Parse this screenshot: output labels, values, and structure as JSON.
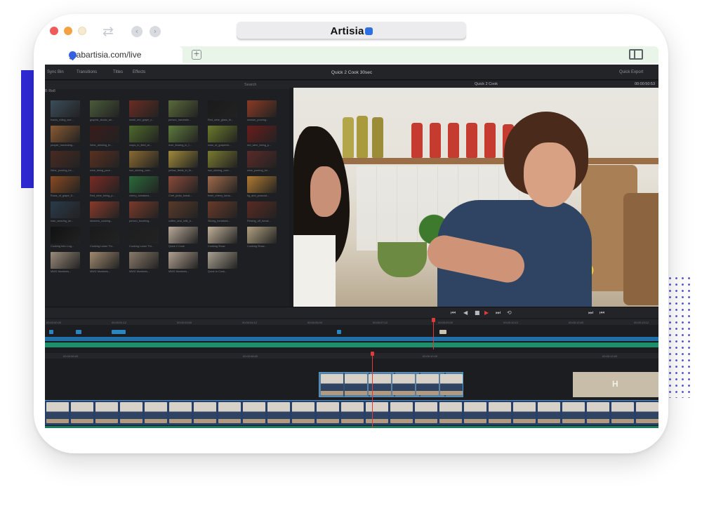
{
  "browser": {
    "brand_name": "Artisia",
    "tab_url": "grabartisia.com/live",
    "new_tab_symbol": "+"
  },
  "app": {
    "topbar": {
      "sync_bin": "Sync Bin",
      "transitions": "Transitions",
      "titles": "Titles",
      "effects": "Effects",
      "project_title": "Quick 2 Cook 30sec",
      "quick_export": "Quick Export"
    },
    "media_pool": {
      "search_label": "Search",
      "bin_label": "B Roll",
      "clips": [
        "tracks_riding_sce...",
        "graphic_studio_an...",
        "small_red_grape_c...",
        "person_harvestin...",
        "Red_wine_glass_bi...",
        "woman_pouring...",
        "people_harvesting...",
        "Wine_drinking_th...",
        "crops_in_field_at...",
        "river_flowing_in_f...",
        "rows_of_grapevin...",
        "red_wine_being_p...",
        "Wine_pouring_int...",
        "wine_being_pour...",
        "sun_shining_over...",
        "yellow_fields_in_th...",
        "sun_shining_over...",
        "wine_pouring_int...",
        "Rows_of_grape_fi...",
        "Red_wine_being_p...",
        "cherry_tomatoes...",
        "Chef_picks_tomat...",
        "fresh_cherry_toma...",
        "fig_and_prosciut...",
        "man_wearing_an...",
        "skewers_cooking...",
        "person_brushing...",
        "coffee_and_milk_b...",
        "Slicing_tomatoes...",
        "Rinsing_off_tomat...",
        "Cooking Intro Log...",
        "Cooking Lower Thi...",
        "Cooking Lower Thi...",
        "Quick 2 Cook",
        "Cooking Show",
        "Cooking Show...",
        "MWG Monitoris...",
        "MWG Monitoris...",
        "MWG Monitoris...",
        "MWG Monitoris...",
        "Quick to Cook..."
      ]
    },
    "viewer": {
      "clip_name": "Quick 2 Cook",
      "timecode": "00:00:50:53"
    },
    "timeline": {
      "mini_ruler": [
        "00:00:00:00",
        "00:00:01:12",
        "00:00:03:00",
        "00:00:04:12",
        "00:00:06:00",
        "00:00:07:12",
        "00:00:09:00",
        "00:00:10:12",
        "00:00:12:00",
        "00:00:13:12"
      ],
      "main_ruler": [
        "00:00:06:00",
        "00:00:08:00",
        "00:00:10:00",
        "00:00:12:00"
      ]
    }
  },
  "colors": {
    "accent_bar": "#2f2ad8",
    "playhead": "#e23a3a",
    "track_blue": "#1f6fa8",
    "track_green": "#1d8f6a"
  },
  "icons": [
    "reload-icon",
    "back-icon",
    "forward-icon",
    "tab-logo-icon",
    "new-tab-icon",
    "sidebar-toggle-icon",
    "play-icon",
    "stop-icon",
    "skip-back-icon",
    "skip-forward-icon",
    "loop-icon"
  ]
}
